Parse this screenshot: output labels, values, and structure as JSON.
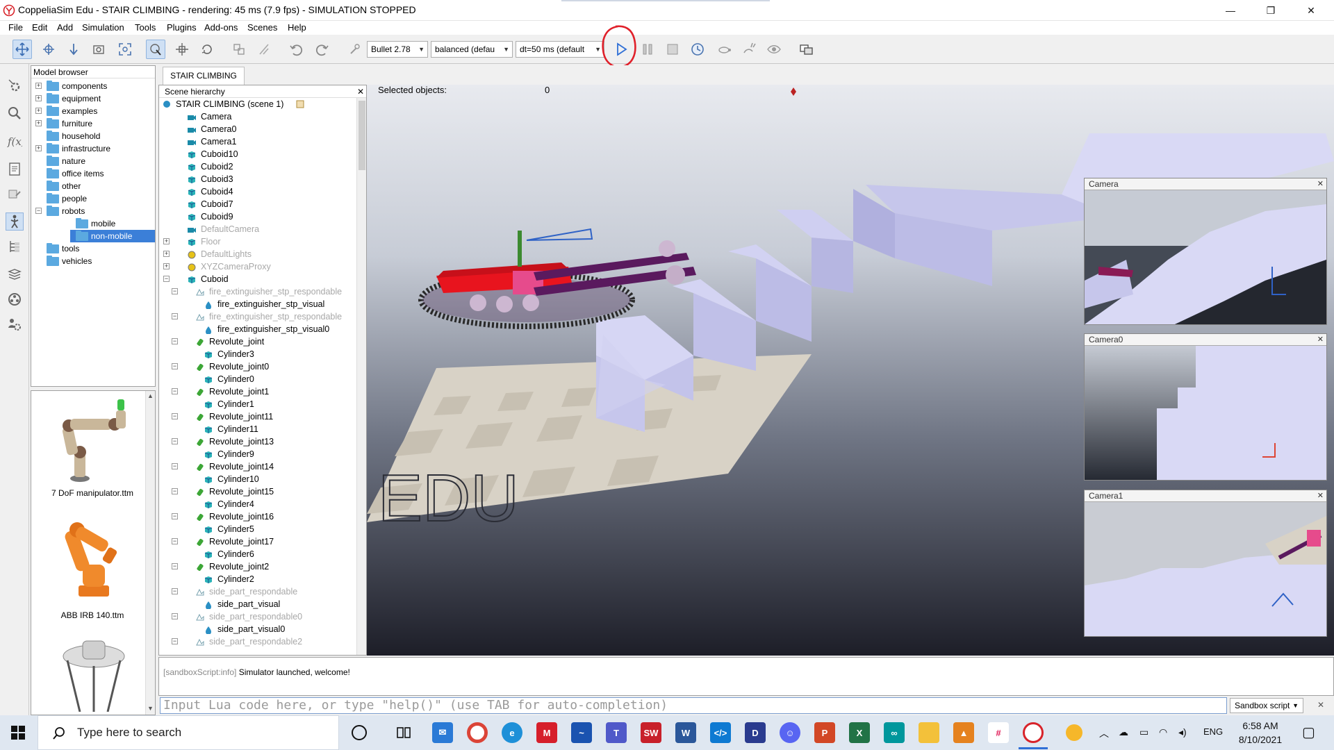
{
  "window": {
    "title": "CoppeliaSim Edu - STAIR CLIMBING - rendering: 45 ms (7.9 fps) - SIMULATION STOPPED",
    "minimize": "—",
    "restore": "❐",
    "close": "✕"
  },
  "menu": [
    "File",
    "Edit",
    "Add",
    "Simulation",
    "Tools",
    "Plugins",
    "Add-ons",
    "Scenes",
    "Help"
  ],
  "toolbar": {
    "engine": "Bullet 2.78",
    "accuracy": "balanced (defau",
    "timestep": "dt=50 ms (default"
  },
  "model_browser": {
    "title": "Model browser",
    "folders": [
      {
        "label": "components",
        "expand": "+"
      },
      {
        "label": "equipment",
        "expand": "+"
      },
      {
        "label": "examples",
        "expand": "+"
      },
      {
        "label": "furniture",
        "expand": "+"
      },
      {
        "label": "household",
        "expand": ""
      },
      {
        "label": "infrastructure",
        "expand": "+"
      },
      {
        "label": "nature",
        "expand": ""
      },
      {
        "label": "office items",
        "expand": ""
      },
      {
        "label": "other",
        "expand": ""
      },
      {
        "label": "people",
        "expand": ""
      },
      {
        "label": "robots",
        "expand": "−"
      },
      {
        "label": "mobile",
        "expand": ""
      },
      {
        "label": "non-mobile",
        "expand": ""
      },
      {
        "label": "tools",
        "expand": ""
      },
      {
        "label": "vehicles",
        "expand": ""
      }
    ],
    "thumbnails": [
      "7 DoF manipulator.ttm",
      "ABB IRB 140.ttm"
    ]
  },
  "scene_tab": "STAIR CLIMBING",
  "hierarchy": {
    "title": "Scene hierarchy",
    "close": "✕",
    "root": "STAIR CLIMBING (scene 1)",
    "items": [
      {
        "label": "Camera",
        "type": "camera",
        "gray": false
      },
      {
        "label": "Camera0",
        "type": "camera",
        "gray": false
      },
      {
        "label": "Camera1",
        "type": "camera",
        "gray": false
      },
      {
        "label": "Cuboid10",
        "type": "shape",
        "gray": false
      },
      {
        "label": "Cuboid2",
        "type": "shape",
        "gray": false
      },
      {
        "label": "Cuboid3",
        "type": "shape",
        "gray": false
      },
      {
        "label": "Cuboid4",
        "type": "shape",
        "gray": false
      },
      {
        "label": "Cuboid7",
        "type": "shape",
        "gray": false
      },
      {
        "label": "Cuboid9",
        "type": "shape",
        "gray": false
      },
      {
        "label": "DefaultCamera",
        "type": "camera",
        "gray": true
      },
      {
        "label": "Floor",
        "type": "shape",
        "gray": true
      },
      {
        "label": "DefaultLights",
        "type": "light",
        "gray": true
      },
      {
        "label": "XYZCameraProxy",
        "type": "light",
        "gray": true
      },
      {
        "label": "Cuboid",
        "type": "shape",
        "gray": false
      },
      {
        "label": "fire_extinguisher_stp_respondable",
        "type": "resp",
        "gray": true
      },
      {
        "label": "fire_extinguisher_stp_visual",
        "type": "visual",
        "gray": false
      },
      {
        "label": "fire_extinguisher_stp_respondable",
        "type": "resp",
        "gray": true
      },
      {
        "label": "fire_extinguisher_stp_visual0",
        "type": "visual",
        "gray": false
      },
      {
        "label": "Revolute_joint",
        "type": "joint",
        "gray": false
      },
      {
        "label": "Cylinder3",
        "type": "shape",
        "gray": false
      },
      {
        "label": "Revolute_joint0",
        "type": "joint",
        "gray": false
      },
      {
        "label": "Cylinder0",
        "type": "shape",
        "gray": false
      },
      {
        "label": "Revolute_joint1",
        "type": "joint",
        "gray": false
      },
      {
        "label": "Cylinder1",
        "type": "shape",
        "gray": false
      },
      {
        "label": "Revolute_joint11",
        "type": "joint",
        "gray": false
      },
      {
        "label": "Cylinder11",
        "type": "shape",
        "gray": false
      },
      {
        "label": "Revolute_joint13",
        "type": "joint",
        "gray": false
      },
      {
        "label": "Cylinder9",
        "type": "shape",
        "gray": false
      },
      {
        "label": "Revolute_joint14",
        "type": "joint",
        "gray": false
      },
      {
        "label": "Cylinder10",
        "type": "shape",
        "gray": false
      },
      {
        "label": "Revolute_joint15",
        "type": "joint",
        "gray": false
      },
      {
        "label": "Cylinder4",
        "type": "shape",
        "gray": false
      },
      {
        "label": "Revolute_joint16",
        "type": "joint",
        "gray": false
      },
      {
        "label": "Cylinder5",
        "type": "shape",
        "gray": false
      },
      {
        "label": "Revolute_joint17",
        "type": "joint",
        "gray": false
      },
      {
        "label": "Cylinder6",
        "type": "shape",
        "gray": false
      },
      {
        "label": "Revolute_joint2",
        "type": "joint",
        "gray": false
      },
      {
        "label": "Cylinder2",
        "type": "shape",
        "gray": false
      },
      {
        "label": "side_part_respondable",
        "type": "resp",
        "gray": true
      },
      {
        "label": "side_part_visual",
        "type": "visual",
        "gray": false
      },
      {
        "label": "side_part_respondable0",
        "type": "resp",
        "gray": true
      },
      {
        "label": "side_part_visual0",
        "type": "visual",
        "gray": false
      },
      {
        "label": "side_part_respondable2",
        "type": "resp",
        "gray": true
      }
    ]
  },
  "viewport": {
    "selected_label": "Selected objects:",
    "selected_count": "0",
    "watermark": "EDU",
    "views": [
      "Camera",
      "Camera0",
      "Camera1"
    ],
    "view_close": "✕"
  },
  "console": {
    "tag": "[sandboxScript:info]",
    "message": "Simulator launched, welcome!"
  },
  "lua": {
    "placeholder": "Input Lua code here, or type \"help()\" (use TAB for auto-completion)",
    "script_select": "Sandbox script",
    "close": "✕"
  },
  "taskbar": {
    "search_placeholder": "Type here to search",
    "language": "ENG",
    "time": "6:58 AM",
    "date": "8/10/2021"
  },
  "colors": {
    "accent": "#2f6fd6",
    "play_circle": "#e0202a",
    "robot_red": "#e8141e",
    "robot_purple": "#5a1a5e",
    "stairs": "#c9c9ec"
  }
}
